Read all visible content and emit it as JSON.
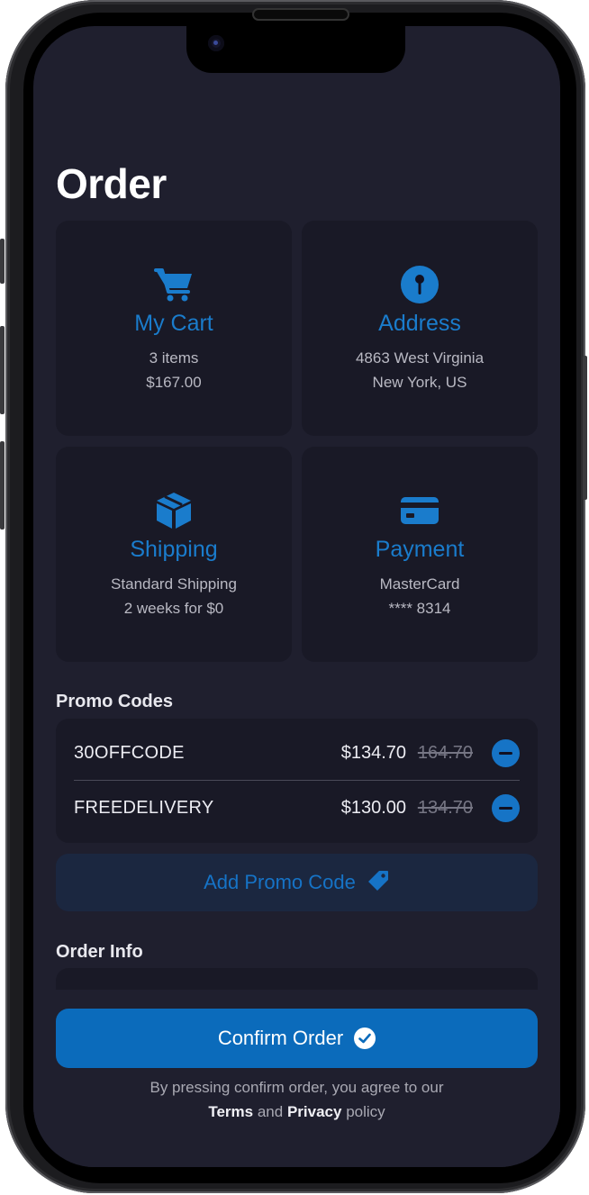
{
  "page_title": "Order",
  "cards": {
    "cart": {
      "icon": "cart-icon",
      "title": "My Cart",
      "line1": "3 items",
      "line2": "$167.00"
    },
    "address": {
      "icon": "map-pin-icon",
      "title": "Address",
      "line1": "4863 West Virginia",
      "line2": "New York, US"
    },
    "shipping": {
      "icon": "package-icon",
      "title": "Shipping",
      "line1": "Standard Shipping",
      "line2": "2 weeks for $0"
    },
    "payment": {
      "icon": "credit-card-icon",
      "title": "Payment",
      "line1": "MasterCard",
      "line2": "**** 8314"
    }
  },
  "promo_codes": {
    "label": "Promo Codes",
    "items": [
      {
        "code": "30OFFCODE",
        "new_price": "$134.70",
        "old_price": "164.70"
      },
      {
        "code": "FREEDELIVERY",
        "new_price": "$130.00",
        "old_price": "134.70"
      }
    ],
    "add_label": "Add Promo Code",
    "add_icon": "tag-icon"
  },
  "order_info": {
    "label": "Order Info"
  },
  "confirm": {
    "label": "Confirm Order",
    "icon": "checkmark-circle-icon"
  },
  "legal": {
    "prefix": "By pressing confirm order, you agree to our",
    "terms": "Terms",
    "and": "and",
    "privacy": "Privacy",
    "suffix": "policy"
  },
  "colors": {
    "accent": "#0b6bbb",
    "accent_text": "#1a7ccc",
    "background": "#1f1f2e",
    "card": "#191926"
  }
}
